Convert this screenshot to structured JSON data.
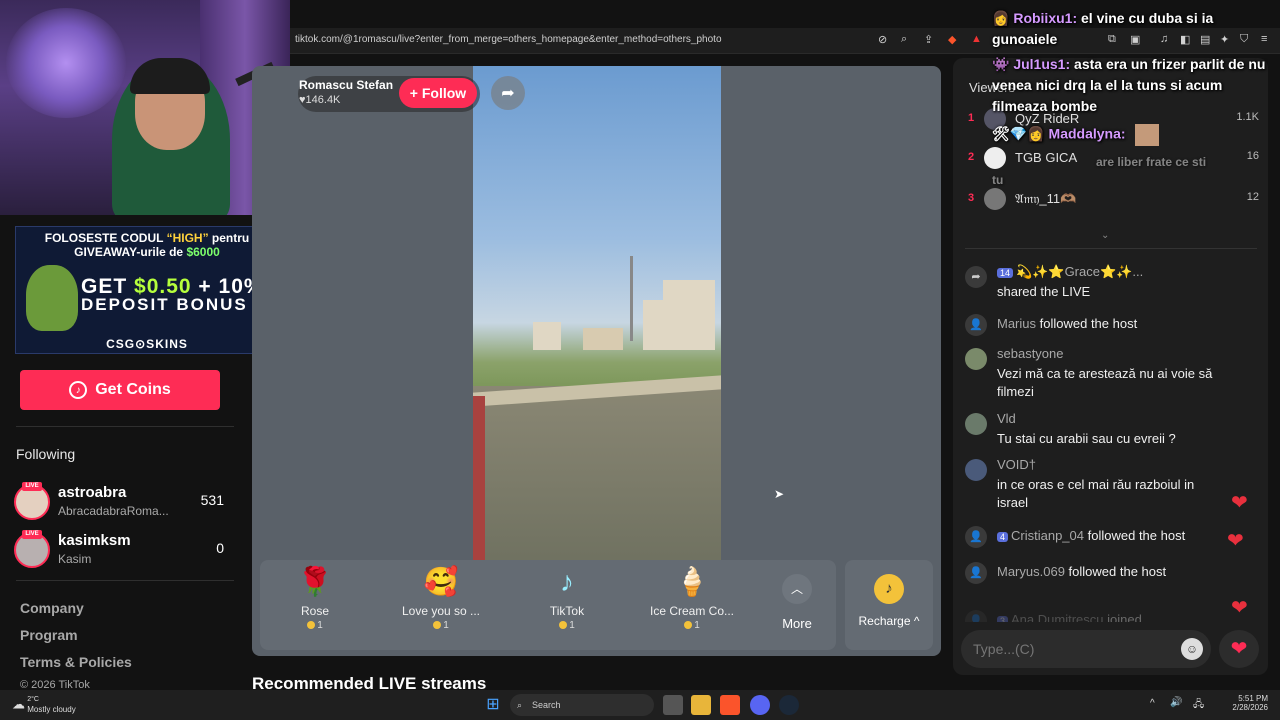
{
  "browser": {
    "url": "tiktok.com/@1romascu/live?enter_from_merge=others_homepage&enter_method=others_photo"
  },
  "overlay_chat": [
    {
      "user": "Robiixu1:",
      "text": "el vine cu duba si ia gunoaiele"
    },
    {
      "user": "Jul1us1:",
      "text": "asta era un frizer parlit de nu venea nici drq la el la tuns si acum filmeaza bombe"
    },
    {
      "user": "Maddalyna:",
      "text": ""
    }
  ],
  "ad": {
    "line1_pre": "FOLOSESTE CODUL ",
    "line1_code": "“HIGH”",
    "line1_post": " pentru",
    "line2_pre": "GIVEAWAY-urile de ",
    "line2_amount": "$6000",
    "get": "GET ",
    "amount": "$0.50",
    "plus": " + 10%",
    "line4": "DEPOSIT BONUS",
    "brand": "CSG⊙SKINS"
  },
  "sidebar": {
    "get_coins": "Get Coins",
    "following_heading": "Following",
    "following": [
      {
        "name": "astroabra",
        "sub": "AbracadabraRoma...",
        "count": "531",
        "badge": "LIVE"
      },
      {
        "name": "kasimksm",
        "sub": "Kasim",
        "count": "0",
        "badge": "LIVE"
      }
    ],
    "footer": [
      "Company",
      "Program",
      "Terms & Policies",
      "© 2026 TikTok"
    ]
  },
  "player": {
    "host_name": "Romascu Stefan",
    "likes": "♥146.4K",
    "follow": "+ Follow",
    "share_icon": "share-icon"
  },
  "gifts": [
    {
      "icon": "🌹",
      "name": "Rose",
      "price": "1"
    },
    {
      "icon": "🥰",
      "name": "Love you so ...",
      "price": "1"
    },
    {
      "icon": "♪",
      "name": "TikTok",
      "price": "1"
    },
    {
      "icon": "🍦",
      "name": "Ice Cream Co...",
      "price": "1"
    }
  ],
  "more_label": "More",
  "recharge_label": "Recharge ^",
  "recommended_heading": "Recommended LIVE streams",
  "viewers": {
    "label": "Viewers",
    "list": [
      {
        "rank": "1",
        "name": "QyZ RideR",
        "score": "1.1K"
      },
      {
        "rank": "2",
        "name": "TGB GICA",
        "score": "16"
      },
      {
        "rank": "3",
        "name": "𝔄𝔪𝔶_11🫶🏽",
        "score": "12"
      }
    ]
  },
  "overlay_ghost": "are liber frate ce sti",
  "overlay_ghost2": "tu",
  "chat": [
    {
      "type": "share",
      "level": "14",
      "user": "💫✨⭐Grace⭐✨...",
      "action": "shared the LIVE"
    },
    {
      "type": "follow",
      "user": "Marius",
      "action": "followed the host"
    },
    {
      "type": "msg",
      "user": "sebastyone",
      "text": "Vezi mă ca te arestează nu ai voie să filmezi"
    },
    {
      "type": "msg",
      "user": "Vld",
      "text": "Tu stai cu arabii sau cu evreii ?"
    },
    {
      "type": "msg",
      "user": "VOID†",
      "text": "in ce oras e cel mai rău razboiul in israel"
    },
    {
      "type": "follow",
      "level": "4",
      "user": "Cristianp_04",
      "action": "followed the host"
    },
    {
      "type": "follow",
      "user": "Maryus.069",
      "action": "followed the host"
    },
    {
      "type": "join",
      "level": "3",
      "user": "Ana Dumitrescu",
      "action": "joined"
    }
  ],
  "chat_input_placeholder": "Type...(C)",
  "taskbar": {
    "temp": "2°C",
    "weather": "Mostly cloudy",
    "search": "Search",
    "time": "5:51 PM",
    "date": "2/28/2026"
  },
  "colors": {
    "accent": "#fe2c55",
    "panel": "#1e1e1e",
    "player_bg": "#5a6169"
  }
}
